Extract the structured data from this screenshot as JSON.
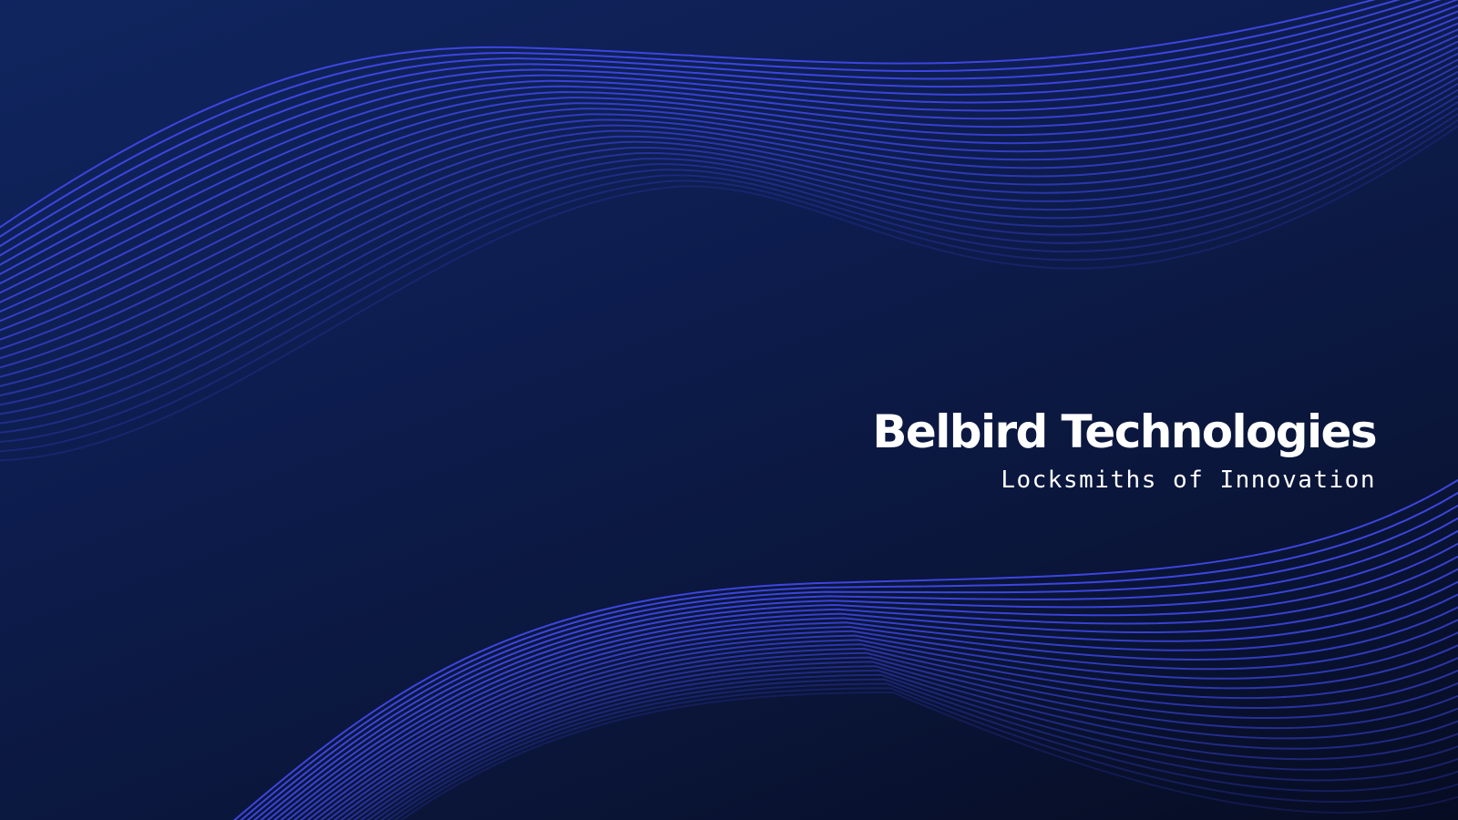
{
  "slide": {
    "company_name": "Belbird Technologies",
    "tagline": "Locksmiths of Innovation"
  },
  "theme": {
    "background_top": "#10255f",
    "background_bottom": "#060c22",
    "wave_color": "#4048e8",
    "text_color": "#ffffff"
  },
  "decoration": {
    "wave_bands": [
      "upper-wave-band",
      "lower-wave-band"
    ]
  }
}
